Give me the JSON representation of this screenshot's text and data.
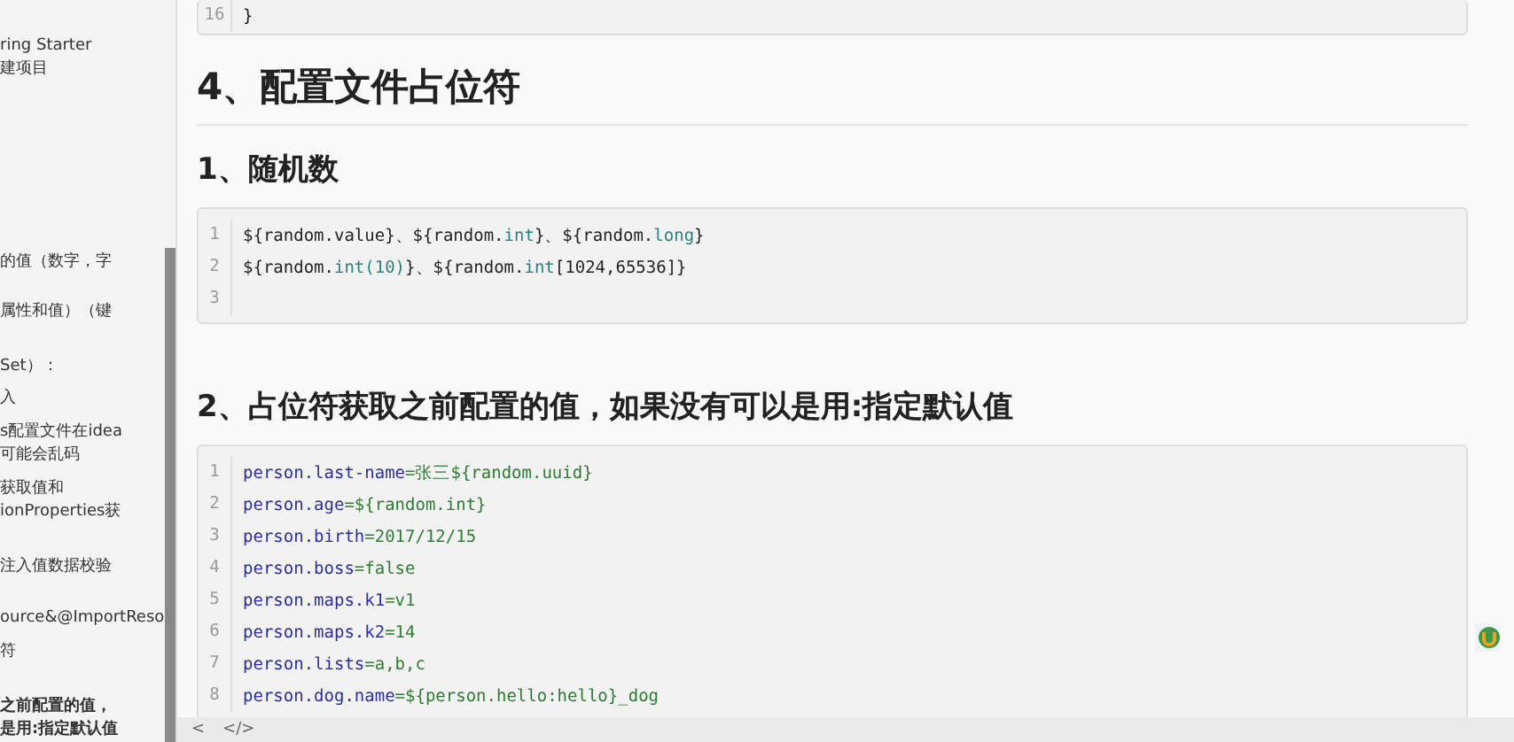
{
  "sidebar": {
    "items": [
      {
        "lines": [
          "ring Starter",
          "建项目"
        ],
        "bold": false
      },
      {
        "lines": [
          "的值（数字，字"
        ],
        "bold": false
      },
      {
        "lines": [
          "属性和值）（键"
        ],
        "bold": false
      },
      {
        "lines": [
          "Set）："
        ],
        "bold": false
      },
      {
        "lines": [
          "入"
        ],
        "bold": false
      },
      {
        "lines": [
          "s配置文件在idea",
          "可能会乱码"
        ],
        "bold": false
      },
      {
        "lines": [
          "获取值和",
          "ionProperties获"
        ],
        "bold": false
      },
      {
        "lines": [
          "注入值数据校验"
        ],
        "bold": false
      },
      {
        "lines": [
          "ource&@ImportReso"
        ],
        "bold": false
      },
      {
        "lines": [
          "符"
        ],
        "bold": false
      },
      {
        "lines": [
          "之前配置的值，",
          "是用:指定默认值"
        ],
        "bold": true
      }
    ]
  },
  "content": {
    "top_code": {
      "lines": [
        {
          "number": "16",
          "segments": [
            {
              "text": "}",
              "kind": "plain"
            }
          ]
        }
      ]
    },
    "heading": "4、配置文件占位符",
    "sections": [
      {
        "title": "1、随机数",
        "code": {
          "lines": [
            {
              "number": "1",
              "segments": [
                {
                  "text": "${random.value}、${random.",
                  "kind": "plain"
                },
                {
                  "text": "int",
                  "kind": "type"
                },
                {
                  "text": "}、${random.",
                  "kind": "plain"
                },
                {
                  "text": "long",
                  "kind": "type"
                },
                {
                  "text": "}",
                  "kind": "plain"
                }
              ]
            },
            {
              "number": "2",
              "segments": [
                {
                  "text": "${random.",
                  "kind": "plain"
                },
                {
                  "text": "int(10)",
                  "kind": "type"
                },
                {
                  "text": "}、${random.",
                  "kind": "plain"
                },
                {
                  "text": "int",
                  "kind": "type"
                },
                {
                  "text": "[1024,65536]}",
                  "kind": "plain"
                }
              ]
            },
            {
              "number": "3"
            }
          ]
        }
      },
      {
        "title": "2、占位符获取之前配置的值，如果没有可以是用:指定默认值",
        "code": {
          "lines": [
            {
              "number": "1",
              "segments": [
                {
                  "text": "person.last-name",
                  "kind": "key"
                },
                {
                  "text": "=张三${random.uuid}",
                  "kind": "value"
                }
              ]
            },
            {
              "number": "2",
              "segments": [
                {
                  "text": "person.age",
                  "kind": "key"
                },
                {
                  "text": "=${random.int}",
                  "kind": "value"
                }
              ]
            },
            {
              "number": "3",
              "segments": [
                {
                  "text": "person.birth",
                  "kind": "key"
                },
                {
                  "text": "=2017/12/15",
                  "kind": "value"
                }
              ]
            },
            {
              "number": "4",
              "segments": [
                {
                  "text": "person.boss",
                  "kind": "key"
                },
                {
                  "text": "=false",
                  "kind": "value"
                }
              ]
            },
            {
              "number": "5",
              "segments": [
                {
                  "text": "person.maps.k1",
                  "kind": "key"
                },
                {
                  "text": "=v1",
                  "kind": "value"
                }
              ]
            },
            {
              "number": "6",
              "segments": [
                {
                  "text": "person.maps.k2",
                  "kind": "key"
                },
                {
                  "text": "=14",
                  "kind": "value"
                }
              ]
            },
            {
              "number": "7",
              "segments": [
                {
                  "text": "person.lists",
                  "kind": "key"
                },
                {
                  "text": "=a,b,c",
                  "kind": "value"
                }
              ]
            },
            {
              "number": "8",
              "segments": [
                {
                  "text": "person.dog.name",
                  "kind": "key"
                },
                {
                  "text": "=${person.hello:hello}_dog",
                  "kind": "value"
                }
              ]
            }
          ]
        }
      }
    ]
  },
  "bottom_bar": {
    "buttons": [
      "<",
      "</>"
    ]
  }
}
